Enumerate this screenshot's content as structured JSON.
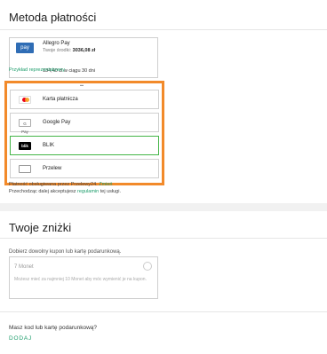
{
  "payment": {
    "title": "Metoda płatności",
    "allegro_pay": {
      "logo_text": "pay",
      "name": "Allegro Pay",
      "funds_label": "Twoje środki:",
      "funds_value": "3036,08 zł",
      "installment": "134,40 zł w ciągu 30 dni"
    },
    "example_link": "Przykład reprezentatywny",
    "methods": [
      {
        "label": "Karta płatnicza",
        "icon": "visa-mastercard-icon"
      },
      {
        "label": "Google Pay",
        "logo_text": "G Pay",
        "icon": "google-pay-icon"
      },
      {
        "label": "BLIK",
        "logo_text": "blik",
        "icon": "blik-icon",
        "selected": true
      },
      {
        "label": "Przelew",
        "icon": "bank-transfer-icon"
      }
    ],
    "note_line1": "Płatność obsługiwana przez Przelewy24.",
    "note_change_link": "Zmień",
    "note_line2_pre": "Przechodząc dalej akceptujesz",
    "note_terms_link": "regulamin",
    "note_line2_post": "tej usługi.",
    "highlight_color": "#f28a2a",
    "selected_color": "#44b547"
  },
  "discounts": {
    "title": "Twoje zniżki",
    "coupon_label": "Dobierz dowolny kupon lub kartę podarunkową.",
    "coupon": {
      "title": "7 Monet",
      "description": "Możesz mieć za najmniej 10 Monet aby móc wymienić je na kupon."
    },
    "code_question": "Masz kod lub kartę podarunkową?",
    "add_label": "DODAJ"
  }
}
